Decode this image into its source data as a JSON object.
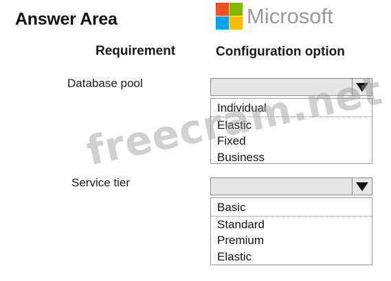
{
  "title": "Answer Area",
  "brand": {
    "name": "Microsoft",
    "colors": [
      "#f25022",
      "#7fba00",
      "#00a4ef",
      "#ffb900"
    ]
  },
  "watermark": "freecram.net",
  "columns": {
    "requirement": "Requirement",
    "configuration": "Configuration option"
  },
  "rows": [
    {
      "label": "Database pool",
      "selected_value": "",
      "options": [
        "Individual",
        "Elastic",
        "Fixed",
        "Business"
      ]
    },
    {
      "label": "Service tier",
      "selected_value": "",
      "options": [
        "Basic",
        "Standard",
        "Premium",
        "Elastic"
      ]
    }
  ],
  "icons": {
    "dropdown": "chevron-down-icon",
    "logo": "microsoft-logo-icon"
  }
}
